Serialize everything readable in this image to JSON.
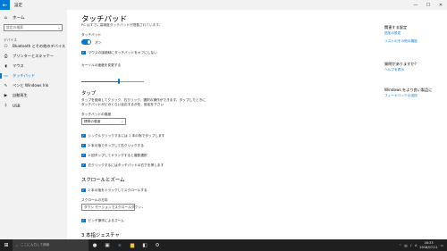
{
  "window": {
    "title": "設定",
    "back_icon": "back-arrow-icon",
    "minimize": "—",
    "maximize": "☐",
    "close": "✕"
  },
  "sidebar": {
    "home_label": "ホーム",
    "search_placeholder": "設定の検索",
    "section_label": "デバイス",
    "items": [
      {
        "label": "Bluetooth とその他のデバイス",
        "icon": "bluetooth-icon",
        "glyph": "⎔"
      },
      {
        "label": "プリンターとスキャナー",
        "icon": "printer-icon",
        "glyph": "⎙"
      },
      {
        "label": "マウス",
        "icon": "mouse-icon",
        "glyph": "◖"
      },
      {
        "label": "タッチパッド",
        "icon": "touchpad-icon",
        "glyph": "▭",
        "active": true
      },
      {
        "label": "ペンと Windows Ink",
        "icon": "pen-icon",
        "glyph": "✎"
      },
      {
        "label": "自動再生",
        "icon": "autoplay-icon",
        "glyph": "▶"
      },
      {
        "label": "USB",
        "icon": "usb-icon",
        "glyph": "⏚"
      }
    ]
  },
  "main": {
    "title": "タッチパッド",
    "subtitle": "PC はすでに高精度タッチパッドが搭載されています。",
    "toggle_section_label": "タッチパッド",
    "toggle_state": "オン",
    "mouse_checkbox": "マウスの接続時にタッチパッドをオフにしない",
    "cursor_speed_label": "カーソルの速度を変更する",
    "cursor_speed_value": 0.6,
    "taps_heading": "タップ",
    "taps_description_1": "タップを使用してクリック、右クリック、選択の操作ができます。タップしたときに",
    "taps_description_2": "タッチパッドがどのくらい反応するかを、設定を下さい",
    "sensitivity_label": "タッチパッドの感度",
    "sensitivity_value": "標準の感度",
    "tap_options": [
      "シングルクリックするには 1 本の指でタップします",
      "2 本の指でタップして右クリックする",
      "2 回タップしてドラッグすると複数選択",
      "右クリックするにはタッチパッドの右下を押します"
    ],
    "scroll_heading": "スクロールとズーム",
    "scroll_option": "2 本の指をドラッグしてスクロールする",
    "scroll_direction_label": "スクロールの方向",
    "scroll_direction_value": "ダウン モーションでスクロールダウン",
    "pinch_option": "ピンチ操作によるズーム",
    "three_finger_heading": "3 本指ジェスチャ"
  },
  "related": {
    "heading": "関連する設定",
    "links": [
      "追加の設定",
      "リストのその他の機能",
      ""
    ],
    "question_heading": "質問がありますか?",
    "question_link": "ヘルプを表示",
    "improve_heading": "Windows をより良い製品に",
    "improve_link": "フィードバックの送信"
  },
  "taskbar": {
    "search_placeholder": "ここに入力して検索",
    "apps": [
      "task-view-icon",
      "edge-icon",
      "folder-icon",
      "store-icon",
      "settings-icon"
    ],
    "time": "16:33",
    "date": "2018/07/11"
  },
  "colors": {
    "accent": "#0078d7",
    "sidebar_bg": "#f2f2f2",
    "taskbar_bg": "#1f1f1f"
  }
}
